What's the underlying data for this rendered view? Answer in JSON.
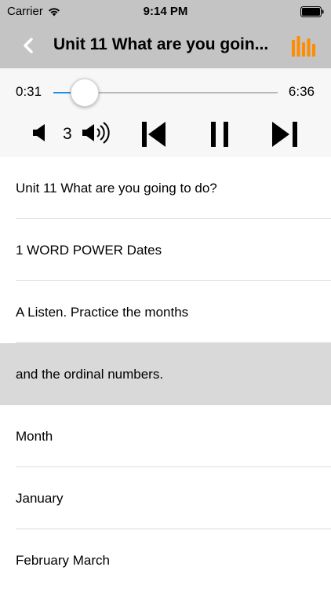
{
  "status_bar": {
    "carrier": "Carrier",
    "time": "9:14 PM",
    "wifi_icon": "wifi-icon",
    "battery_icon": "battery-icon"
  },
  "nav": {
    "back_icon": "chevron-left-icon",
    "title": "Unit 11 What are you goin...",
    "menu_icon": "equalizer-bars-icon",
    "accent_color": "#ff8c00"
  },
  "player": {
    "current_time": "0:31",
    "total_time": "6:36",
    "progress": 0.081,
    "volume": "3",
    "track_color": "#1e8fe8",
    "controls": [
      "volume-down-icon",
      "volume-up-icon",
      "skip-previous-icon",
      "pause-icon",
      "skip-next-icon"
    ]
  },
  "list": {
    "items": [
      {
        "text": "Unit 11 What are you going to do?",
        "selected": false
      },
      {
        "text": "1 WORD POWER Dates",
        "selected": false
      },
      {
        "text": "A Listen. Practice the months",
        "selected": false
      },
      {
        "text": "and the ordinal numbers.",
        "selected": true
      },
      {
        "text": "Month",
        "selected": false
      },
      {
        "text": "January",
        "selected": false
      },
      {
        "text": "February March",
        "selected": false
      }
    ]
  }
}
